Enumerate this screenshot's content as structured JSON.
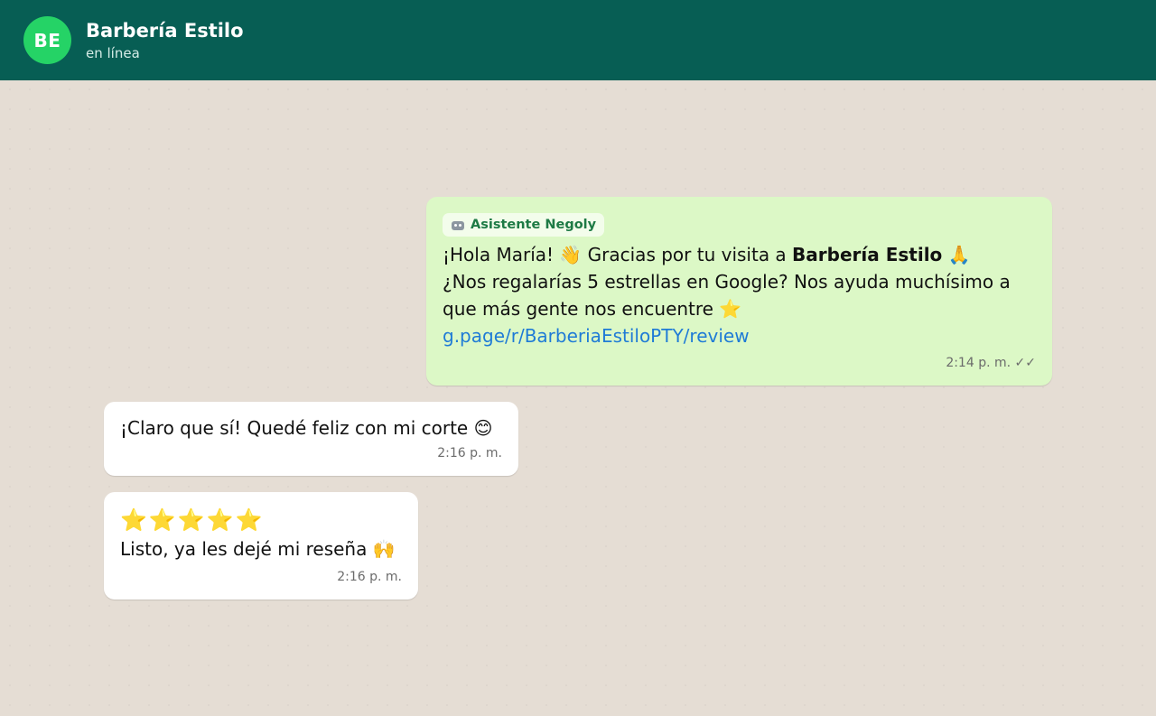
{
  "header": {
    "avatar_initials": "BE",
    "title": "Barbería Estilo",
    "status": "en línea",
    "background_color": "#075e54",
    "avatar_color": "#25d366"
  },
  "messages": [
    {
      "direction": "outgoing",
      "sender_badge": "🤖 Asistente Negoly",
      "sender_badge_icon": "robot-icon",
      "sender_badge_label": "Asistente Negoly",
      "line1_prefix": "¡Hola María! ",
      "line1_emoji1": "👋",
      "line1_middle": " Gracias por tu visita a ",
      "line1_bold": "Barbería Estilo",
      "line1_emoji2": "🙏",
      "line2": "¿Nos regalarías 5 estrellas en Google? Nos ayuda muchísimo a",
      "line3_text": "que más gente nos encuentre ",
      "line3_emoji": "⭐",
      "link": "g.page/r/BarberiaEstiloPTY/review",
      "time": "2:14 p. m.",
      "ticks": "✓✓",
      "bubble_color": "#dcf8c6"
    },
    {
      "direction": "incoming",
      "text": "¡Claro que sí! Quedé feliz con mi corte ",
      "emoji": "😊",
      "time": "2:16 p. m.",
      "bubble_color": "#ffffff"
    },
    {
      "direction": "incoming",
      "stars": "⭐⭐⭐⭐⭐",
      "star_rating": 5,
      "text": "Listo, ya les dejé mi reseña ",
      "emoji": "🙌",
      "time": "2:16 p. m.",
      "bubble_color": "#ffffff"
    }
  ],
  "colors": {
    "chat_background": "#e5ddd4",
    "link": "#1f7bd6",
    "badge_text": "#1e7a45"
  }
}
